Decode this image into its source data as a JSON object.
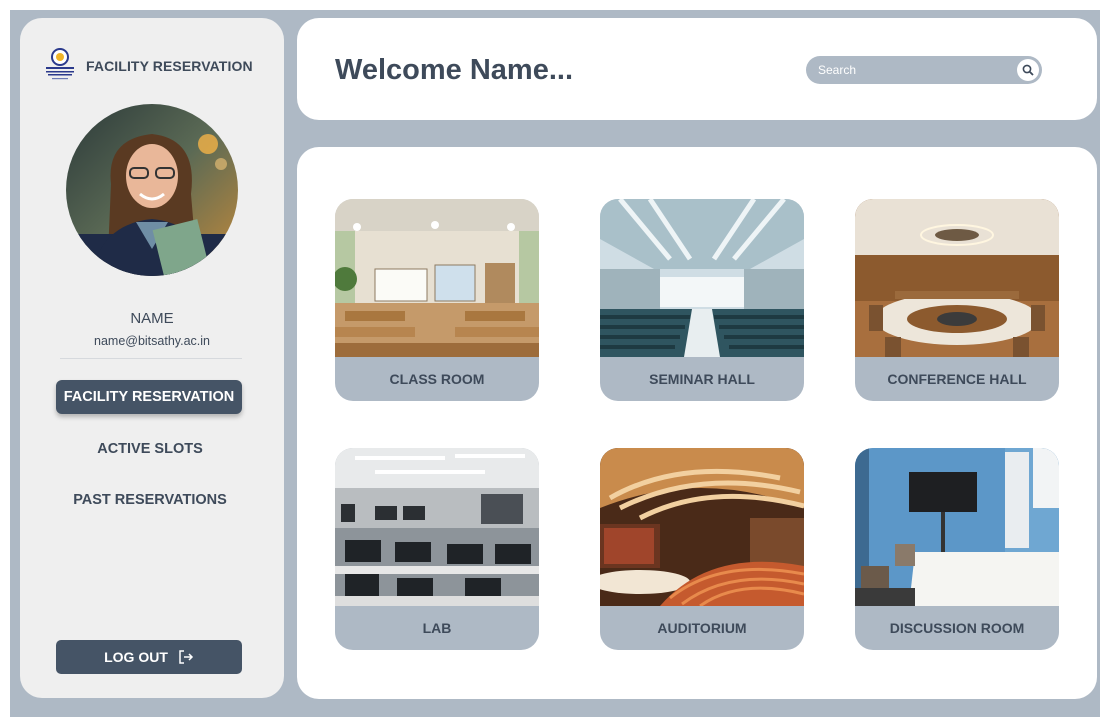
{
  "sidebar": {
    "brand_title": "FACILITY RESERVATION",
    "user": {
      "name": "NAME",
      "email": "name@bitsathy.ac.in"
    },
    "nav": [
      {
        "label": "FACILITY RESERVATION",
        "active": true
      },
      {
        "label": "ACTIVE SLOTS",
        "active": false
      },
      {
        "label": "PAST RESERVATIONS",
        "active": false
      }
    ],
    "logout_label": "LOG OUT"
  },
  "header": {
    "welcome": "Welcome Name...",
    "search_placeholder": "Search"
  },
  "facilities": [
    {
      "label": "CLASS ROOM"
    },
    {
      "label": "SEMINAR HALL"
    },
    {
      "label": "CONFERENCE HALL"
    },
    {
      "label": "LAB"
    },
    {
      "label": "AUDITORIUM"
    },
    {
      "label": "DISCUSSION ROOM"
    }
  ],
  "colors": {
    "background": "#aeb9c5",
    "panel": "#ffffff",
    "sidebar": "#efefef",
    "accent": "#455466",
    "text": "#3e4a5a"
  }
}
